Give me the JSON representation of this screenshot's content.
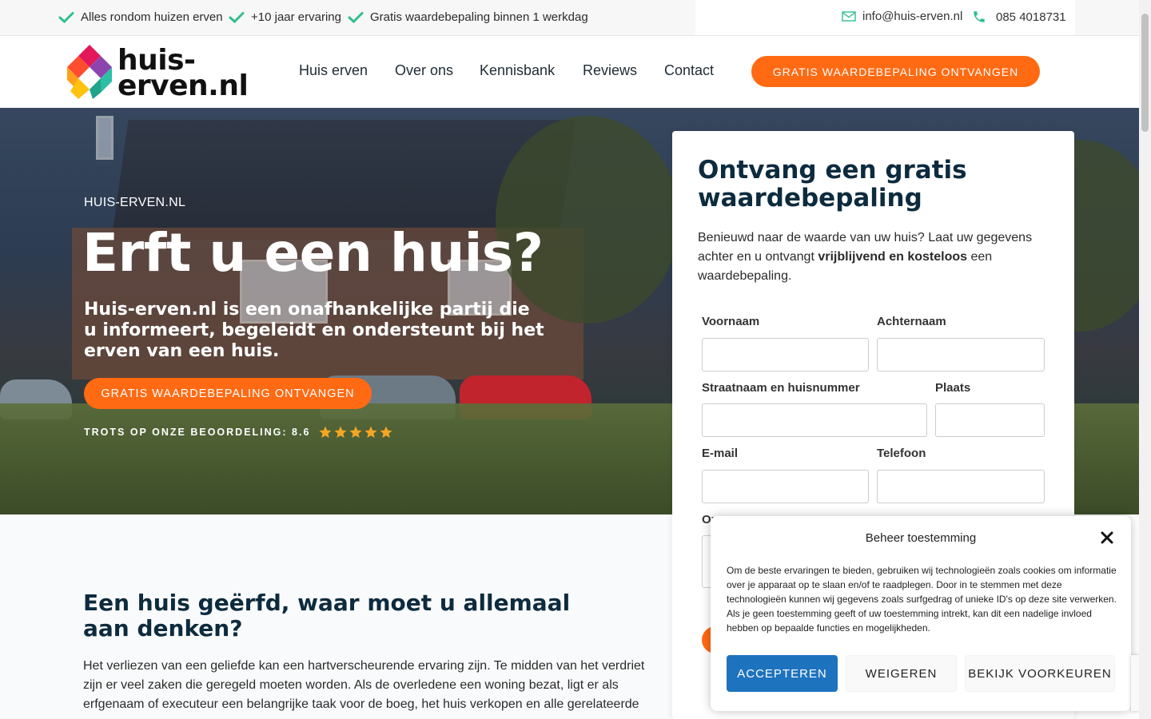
{
  "topbar": {
    "usps": [
      "Alles rondom huizen erven",
      "+10 jaar ervaring",
      "Gratis waardebepaling binnen 1 werkdag"
    ],
    "email": "info@huis-erven.nl",
    "phone": "085 4018731"
  },
  "header": {
    "logo_line1": "huis-",
    "logo_line2": "erven.nl",
    "nav": [
      "Huis erven",
      "Over ons",
      "Kennisbank",
      "Reviews",
      "Contact"
    ],
    "cta": "GRATIS WAARDEBEPALING ONTVANGEN"
  },
  "hero": {
    "label": "HUIS-ERVEN.NL",
    "title": "Erft u een huis?",
    "subtitle": "Huis-erven.nl is een onafhankelijke partij die u informeert, begeleidt en ondersteunt bij het erven van een huis.",
    "cta": "GRATIS WAARDEBEPALING ONTVANGEN",
    "rating_text": "TROTS OP ONZE BEOORDELING: 8.6",
    "rating_stars": 5
  },
  "form": {
    "title": "Ontvang een gratis waardebepaling",
    "intro_pre": "Benieuwd naar de waarde van uw huis? Laat uw gegevens achter en u ontvangt ",
    "intro_bold": "vrijblijvend en kosteloos",
    "intro_post": " een waardebepaling.",
    "labels": {
      "firstname": "Voornaam",
      "lastname": "Achternaam",
      "street": "Straatnaam en huisnummer",
      "city": "Plaats",
      "email": "E-mail",
      "phone": "Telefoon",
      "partial": "Or"
    }
  },
  "content": {
    "title": "Een huis geërfd, waar moet u allemaal aan denken?",
    "body": "Het verliezen van een geliefde kan een hartverscheurende ervaring zijn. Te midden van het verdriet zijn er veel zaken die geregeld moeten worden. Als de overledene een woning bezat, ligt er als erfgenaam of executeur een belangrijke taak voor de boeg, het huis verkopen en alle gerelateerde"
  },
  "cookie": {
    "title": "Beheer toestemming",
    "text": "Om de beste ervaringen te bieden, gebruiken wij technologieën zoals cookies om informatie over je apparaat op te slaan en/of te raadplegen. Door in te stemmen met deze technologieën kunnen wij gegevens zoals surfgedrag of unieke ID's op deze site verwerken. Als je geen toestemming geeft of uw toestemming intrekt, kan dit een nadelige invloed hebben op bepaalde functies en mogelijkheden.",
    "accept": "ACCEPTEREN",
    "deny": "WEIGEREN",
    "prefs": "BEKIJK VOORKEUREN"
  },
  "colors": {
    "accent": "#ff6a13",
    "check": "#2fbf8f",
    "navy": "#0d2b3e",
    "cookie_primary": "#1e73be"
  }
}
